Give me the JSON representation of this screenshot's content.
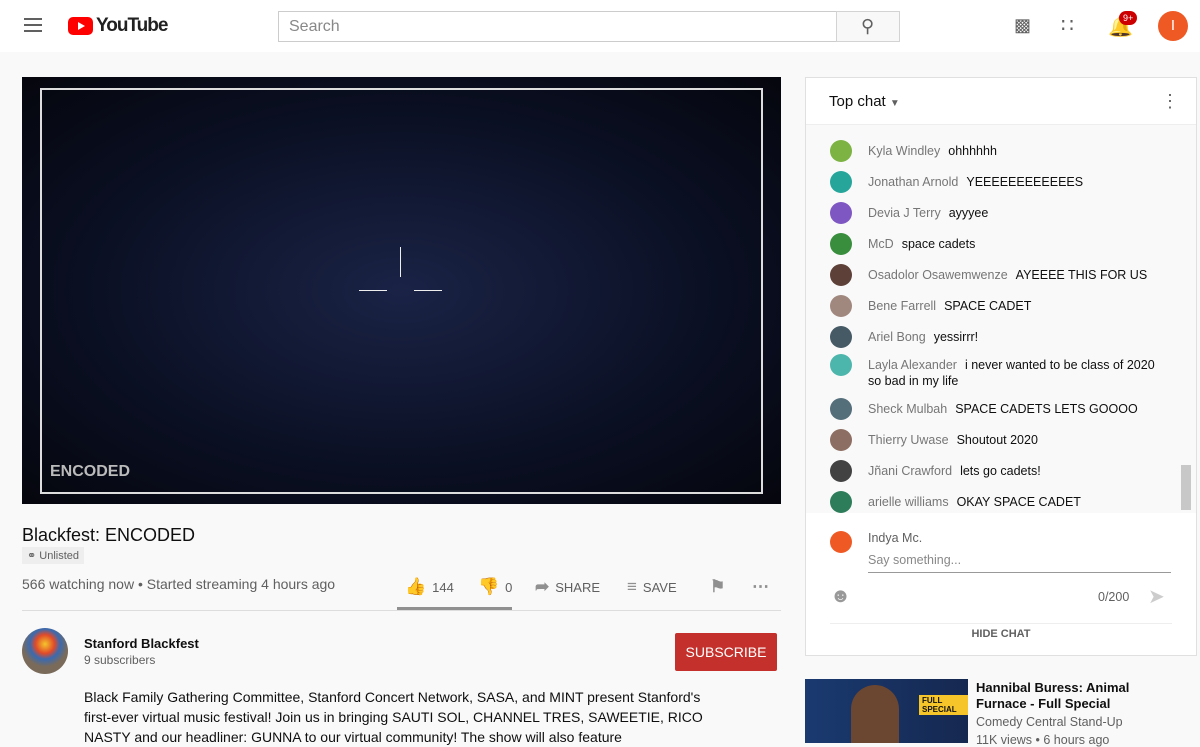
{
  "header": {
    "logo": "YouTube",
    "search_placeholder": "Search",
    "notification_count": "9+",
    "user_initial": "I"
  },
  "video": {
    "title": "Blackfest: ENCODED",
    "visibility": "Unlisted",
    "meta": "566 watching now • Started streaming 4 hours ago",
    "likes": "144",
    "dislikes": "0",
    "share": "SHARE",
    "save": "SAVE",
    "watermark": "ENCODED"
  },
  "channel": {
    "name": "Stanford Blackfest",
    "subscribers": "9 subscribers",
    "subscribe": "SUBSCRIBE"
  },
  "description": "Black Family Gathering Committee, Stanford Concert Network, SASA, and MINT present Stanford's first-ever virtual music festival! Join us in bringing SAUTI SOL, CHANNEL TRES, SAWEETIE, RICO NASTY and our headliner: GUNNA to our virtual community! The show will also feature",
  "chat": {
    "mode": "Top chat",
    "messages": [
      {
        "name": "Kyla Windley",
        "text": "ohhhhhh",
        "color": "#7cb342"
      },
      {
        "name": "Jonathan Arnold",
        "text": "YEEEEEEEEEEEES",
        "color": "#26a69a"
      },
      {
        "name": "Devia J Terry",
        "text": "ayyyee",
        "color": "#7e57c2"
      },
      {
        "name": "McD",
        "text": "space cadets",
        "color": "#388e3c"
      },
      {
        "name": "Osadolor Osawemwenze",
        "text": "AYEEEE THIS FOR US",
        "color": "#5d4037"
      },
      {
        "name": "Bene Farrell",
        "text": "SPACE CADET",
        "color": "#a1887f"
      },
      {
        "name": "Ariel Bong",
        "text": "yessirrr!",
        "color": "#455a64"
      },
      {
        "name": "Layla Alexander",
        "text": "i never wanted to be class of 2020 so bad in my life",
        "color": "#4db6ac"
      },
      {
        "name": "Sheck Mulbah",
        "text": "SPACE CADETS LETS GOOOO",
        "color": "#546e7a"
      },
      {
        "name": "Thierry Uwase",
        "text": "Shoutout 2020",
        "color": "#8d6e63"
      },
      {
        "name": "Jñani Crawford",
        "text": "lets go cadets!",
        "color": "#424242"
      },
      {
        "name": "arielle williams",
        "text": "OKAY SPACE CADET",
        "color": "#2e7d5a"
      }
    ],
    "user": "Indya Mc.",
    "placeholder": "Say something...",
    "counter": "0/200",
    "hide": "HIDE CHAT"
  },
  "recommended": {
    "title": "Hannibal Buress: Animal Furnace - Full Special",
    "channel": "Comedy Central Stand-Up",
    "meta": "11K views • 6 hours ago"
  }
}
